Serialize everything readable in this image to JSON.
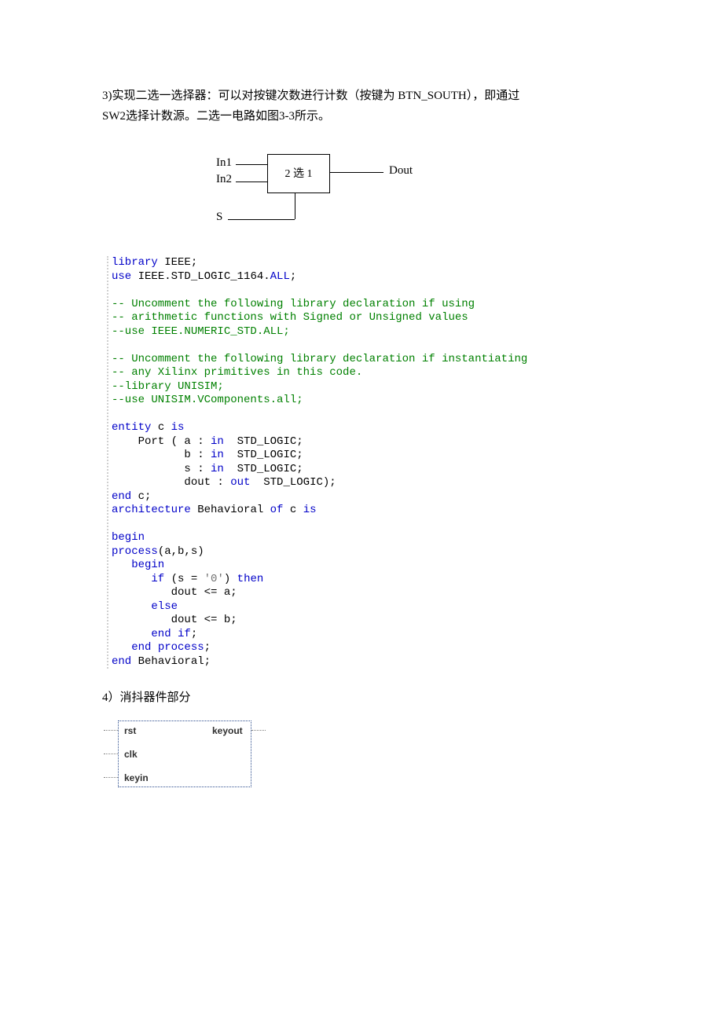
{
  "section3": {
    "line1": "3)实现二选一选择器：可以对按键次数进行计数（按键为 BTN_SOUTH），即通过",
    "line2": "SW2选择计数源。二选一电路如图3-3所示。"
  },
  "mux": {
    "in1": "In1",
    "in2": "In2",
    "s": "S",
    "box": "2 选 1",
    "dout": "Dout"
  },
  "code": {
    "l01a": "library",
    "l01b": " IEEE;",
    "l02a": "use",
    "l02b": " IEEE.STD_LOGIC_1164.",
    "l02c": "ALL",
    "l02d": ";",
    "c1": "-- Uncomment the following library declaration if using",
    "c2": "-- arithmetic functions with Signed or Unsigned values",
    "c3": "--use IEEE.NUMERIC_STD.ALL;",
    "c4": "-- Uncomment the following library declaration if instantiating",
    "c5": "-- any Xilinx primitives in this code.",
    "c6": "--library UNISIM;",
    "c7": "--use UNISIM.VComponents.all;",
    "ent_a": "entity",
    "ent_b": " c ",
    "ent_c": "is",
    "p1a": "    Port ( a : ",
    "p1b": "in",
    "p1c": "  STD_LOGIC;",
    "p2a": "           b : ",
    "p2b": "in",
    "p2c": "  STD_LOGIC;",
    "p3a": "           s : ",
    "p3b": "in",
    "p3c": "  STD_LOGIC;",
    "p4a": "           dout : ",
    "p4b": "out",
    "p4c": "  STD_LOGIC);",
    "endc_a": "end",
    "endc_b": " c;",
    "arch_a": "architecture",
    "arch_b": " Behavioral ",
    "arch_c": "of",
    "arch_d": " c ",
    "arch_e": "is",
    "beg": "begin",
    "proc_a": "process",
    "proc_b": "(a,b,s)",
    "pbeg": "   begin",
    "if_a": "      if ",
    "if_b": "(s = ",
    "if_c": "'0'",
    "if_d": ") ",
    "if_e": "then",
    "as1": "         dout <= a;",
    "else": "      else",
    "as2": "         dout <= b;",
    "endif_a": "      end ",
    "endif_b": "if",
    "endif_c": ";",
    "endp_a": "   end ",
    "endp_b": "process",
    "endp_c": ";",
    "enda_a": "end",
    "enda_b": " Behavioral;"
  },
  "section4": {
    "title": "4）消抖器件部分"
  },
  "debounce": {
    "rst": "rst",
    "clk": "clk",
    "keyin": "keyin",
    "keyout": "keyout"
  }
}
